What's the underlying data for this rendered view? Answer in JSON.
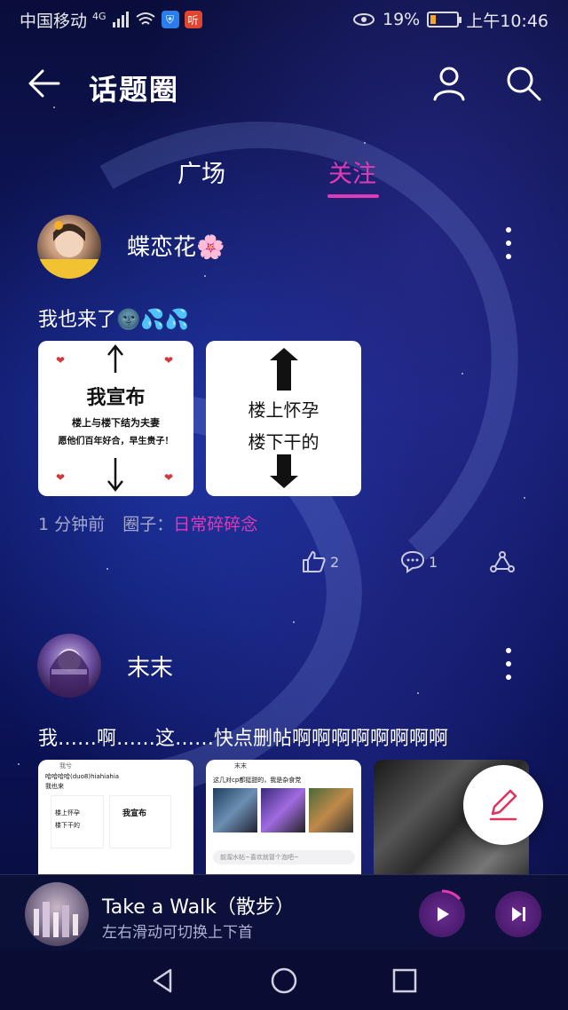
{
  "status_bar": {
    "carrier": "中国移动",
    "network": "4G",
    "app_badge": "听",
    "battery_percent": "19%",
    "time": "上午10:46",
    "battery_color": "#f6a623"
  },
  "header": {
    "title": "话题圈",
    "back_icon": "arrow-left-icon",
    "profile_icon": "user-icon",
    "search_icon": "search-icon"
  },
  "tabs": [
    {
      "label": "广场",
      "active": false
    },
    {
      "label": "关注",
      "active": true
    }
  ],
  "accent_color": "#e03ab6",
  "posts": [
    {
      "username": "蝶恋花🌸",
      "text": "我也来了🌚💦💦",
      "images": [
        {
          "top": "我宣布",
          "line1": "楼上与楼下结为夫妻",
          "line2": "愿他们百年好合，早生贵子！"
        },
        {
          "line1": "楼上怀孕",
          "line2": "楼下干的"
        }
      ],
      "time": "1 分钟前",
      "circle_label": "圈子：",
      "circle_name": "日常碎碎念",
      "likes": "2",
      "comments": "1"
    },
    {
      "username": "末末",
      "text": "我……啊……这……快点删帖啊啊啊啊啊啊啊啊",
      "images": [
        {
          "username": "我兮",
          "line1": "哈哈哈哈(duo8)hiahiahia",
          "line2": "我也来",
          "inner1": "楼上怀孕",
          "inner2": "楼下干的",
          "inner3": "我宣布"
        },
        {
          "username": "末末",
          "line1": "这几对cp都挺甜的，我是杂食党",
          "input": "前溜水帖~喜欢就冒个泡吧~"
        },
        {}
      ]
    }
  ],
  "player": {
    "song": "Take a Walk（散步）",
    "hint": "左右滑动可切换上下首",
    "play_icon": "play-icon",
    "next_icon": "skip-next-icon"
  }
}
